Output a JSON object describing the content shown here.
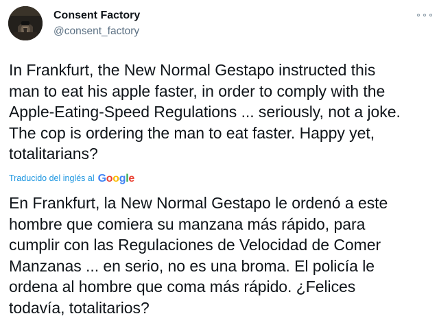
{
  "user": {
    "display_name": "Consent Factory",
    "handle": "@consent_factory",
    "avatar_icon": "avatar-image"
  },
  "tweet": {
    "original_text": "In Frankfurt, the New Normal Gestapo instructed this\nman to eat his apple faster, in order to comply with the\nApple-Eating-Speed Regulations ... seriously, not a joke.\nThe cop is ordering the man to eat faster. Happy yet,\ntotalitarians?",
    "translation_label": "Traducido del inglés al",
    "translation_provider": {
      "parts": [
        "G",
        "o",
        "o",
        "g",
        "l",
        "e"
      ],
      "colors": [
        "#4285f4",
        "#ea4335",
        "#fbbc05",
        "#4285f4",
        "#34a853",
        "#ea4335"
      ]
    },
    "translated_text": "En Frankfurt, la New Normal Gestapo le ordenó a este\nhombre que comiera su manzana más rápido, para\ncumplir con las Regulaciones de Velocidad de Comer\nManzanas ... en serio, no es una broma. El policía le\nordena al hombre que coma más rápido. ¿Felices\ntodavía, totalitarios?"
  },
  "menu": {
    "icon": "more-options-icon"
  }
}
